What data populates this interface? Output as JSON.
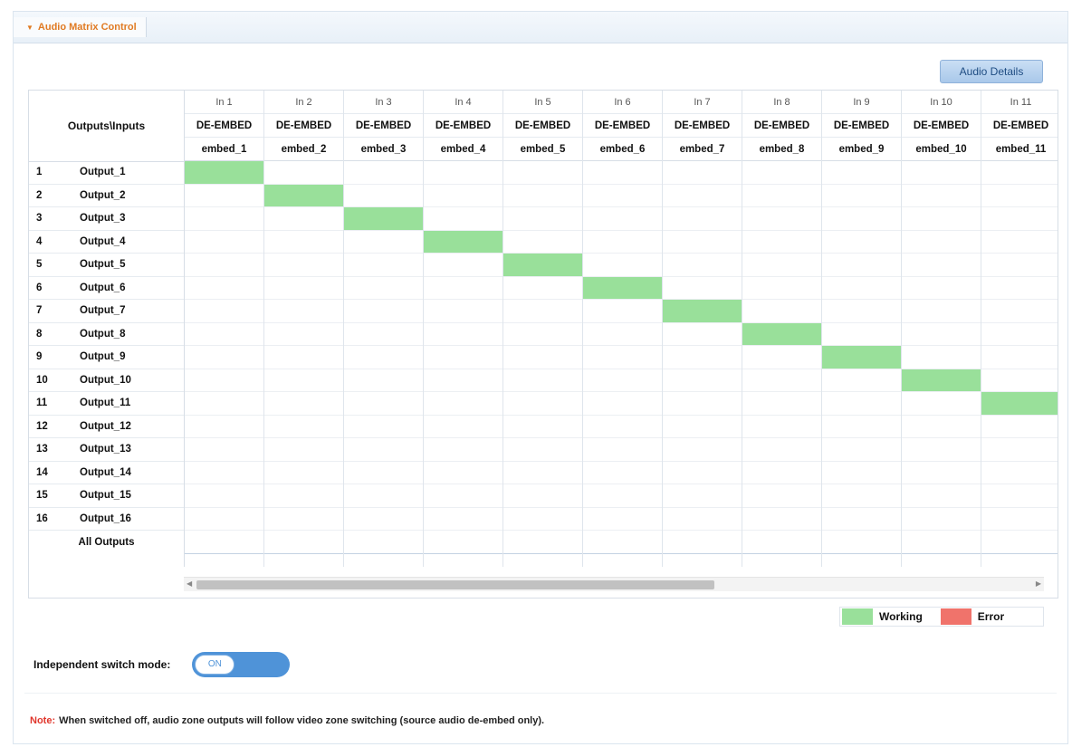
{
  "panel": {
    "title": "Audio Matrix Control"
  },
  "buttons": {
    "audio_details": "Audio Details"
  },
  "matrix": {
    "corner_label": "Outputs\\Inputs",
    "inputs": [
      {
        "label": "In 1",
        "mode": "DE-EMBED",
        "source": "embed_1"
      },
      {
        "label": "In 2",
        "mode": "DE-EMBED",
        "source": "embed_2"
      },
      {
        "label": "In 3",
        "mode": "DE-EMBED",
        "source": "embed_3"
      },
      {
        "label": "In 4",
        "mode": "DE-EMBED",
        "source": "embed_4"
      },
      {
        "label": "In 5",
        "mode": "DE-EMBED",
        "source": "embed_5"
      },
      {
        "label": "In 6",
        "mode": "DE-EMBED",
        "source": "embed_6"
      },
      {
        "label": "In 7",
        "mode": "DE-EMBED",
        "source": "embed_7"
      },
      {
        "label": "In 8",
        "mode": "DE-EMBED",
        "source": "embed_8"
      },
      {
        "label": "In 9",
        "mode": "DE-EMBED",
        "source": "embed_9"
      },
      {
        "label": "In 10",
        "mode": "DE-EMBED",
        "source": "embed_10"
      },
      {
        "label": "In 11",
        "mode": "DE-EMBED",
        "source": "embed_11"
      }
    ],
    "outputs": [
      {
        "num": "1",
        "name": "Output_1"
      },
      {
        "num": "2",
        "name": "Output_2"
      },
      {
        "num": "3",
        "name": "Output_3"
      },
      {
        "num": "4",
        "name": "Output_4"
      },
      {
        "num": "5",
        "name": "Output_5"
      },
      {
        "num": "6",
        "name": "Output_6"
      },
      {
        "num": "7",
        "name": "Output_7"
      },
      {
        "num": "8",
        "name": "Output_8"
      },
      {
        "num": "9",
        "name": "Output_9"
      },
      {
        "num": "10",
        "name": "Output_10"
      },
      {
        "num": "11",
        "name": "Output_11"
      },
      {
        "num": "12",
        "name": "Output_12"
      },
      {
        "num": "13",
        "name": "Output_13"
      },
      {
        "num": "14",
        "name": "Output_14"
      },
      {
        "num": "15",
        "name": "Output_15"
      },
      {
        "num": "16",
        "name": "Output_16"
      }
    ],
    "all_outputs_label": "All Outputs",
    "active_routes": [
      [
        1,
        1
      ],
      [
        2,
        2
      ],
      [
        3,
        3
      ],
      [
        4,
        4
      ],
      [
        5,
        5
      ],
      [
        6,
        6
      ],
      [
        7,
        7
      ],
      [
        8,
        8
      ],
      [
        9,
        9
      ],
      [
        10,
        10
      ],
      [
        11,
        11
      ]
    ]
  },
  "legend": {
    "working_label": "Working",
    "working_color": "#99e09a",
    "error_label": "Error",
    "error_color": "#f0736b"
  },
  "switch": {
    "label": "Independent switch mode:",
    "state": "ON"
  },
  "note": {
    "label": "Note:",
    "text": "When switched off, audio zone outputs will follow video zone switching (source audio de-embed only)."
  }
}
